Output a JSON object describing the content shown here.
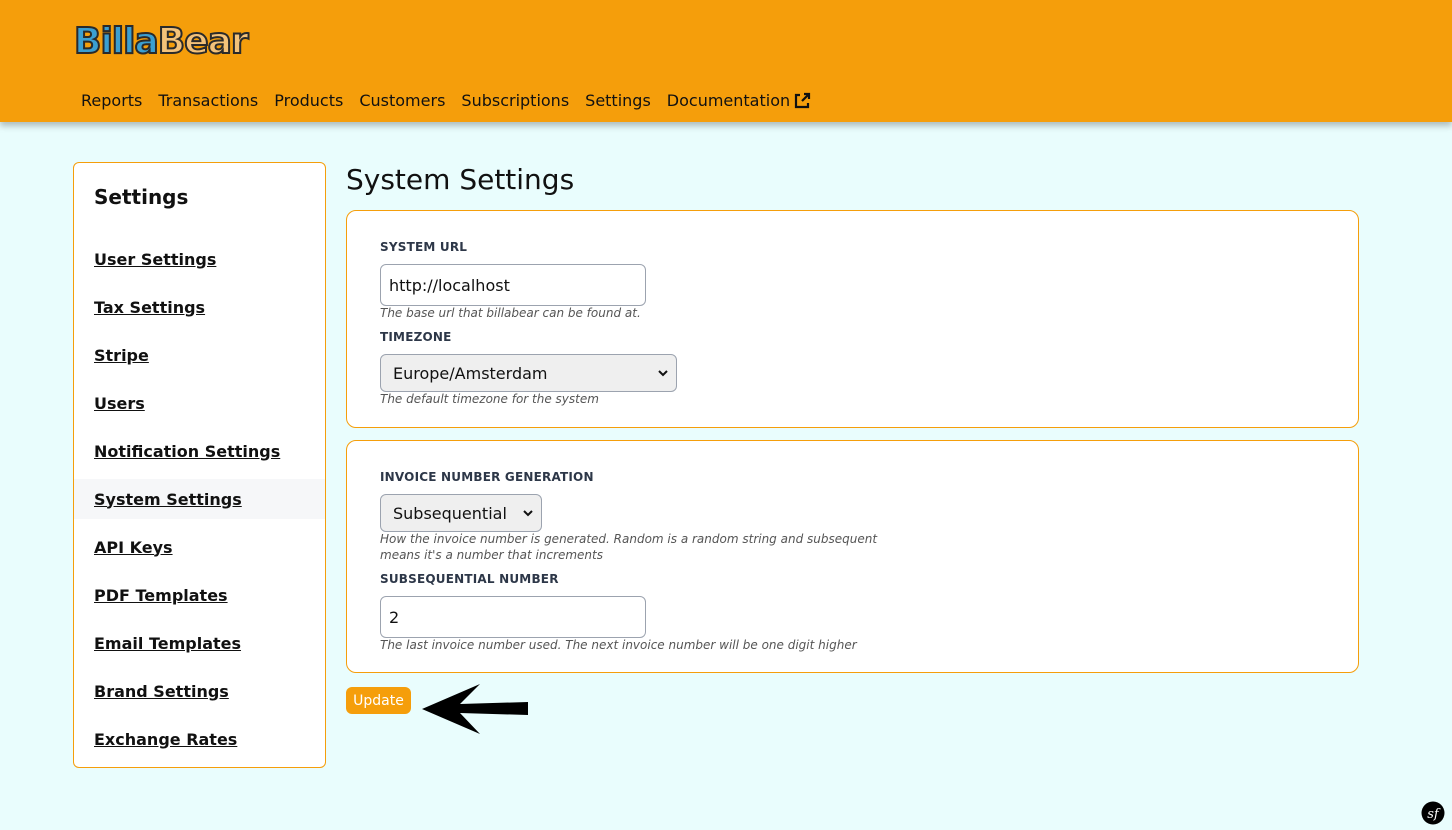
{
  "header": {
    "logo_part1": "Billa",
    "logo_part2": "Bear",
    "nav": [
      {
        "label": "Reports"
      },
      {
        "label": "Transactions"
      },
      {
        "label": "Products"
      },
      {
        "label": "Customers"
      },
      {
        "label": "Subscriptions"
      },
      {
        "label": "Settings"
      },
      {
        "label": "Documentation",
        "icon": "external-link-icon"
      }
    ]
  },
  "sidebar": {
    "title": "Settings",
    "items": [
      {
        "label": "User Settings"
      },
      {
        "label": "Tax Settings"
      },
      {
        "label": "Stripe"
      },
      {
        "label": "Users"
      },
      {
        "label": "Notification Settings"
      },
      {
        "label": "System Settings",
        "active": true
      },
      {
        "label": "API Keys"
      },
      {
        "label": "PDF Templates"
      },
      {
        "label": "Email Templates"
      },
      {
        "label": "Brand Settings"
      },
      {
        "label": "Exchange Rates"
      }
    ]
  },
  "main": {
    "title": "System Settings",
    "system_url": {
      "label": "SYSTEM URL",
      "value": "http://localhost",
      "help": "The base url that billabear can be found at."
    },
    "timezone": {
      "label": "TIMEZONE",
      "value": "Europe/Amsterdam",
      "help": "The default timezone for the system"
    },
    "invoice_number_generation": {
      "label": "INVOICE NUMBER GENERATION",
      "value": "Subsequential",
      "help_line1": "How the invoice number is generated. Random is a random string and subsequent",
      "help_line2": "means it's a number that increments"
    },
    "subsequential_number": {
      "label": "SUBSEQUENTIAL NUMBER",
      "value": "2",
      "help": "The last invoice number used. The next invoice number will be one digit higher"
    },
    "update_label": "Update"
  },
  "colors": {
    "accent": "#f59e0b",
    "background": "#e9fdfd"
  }
}
